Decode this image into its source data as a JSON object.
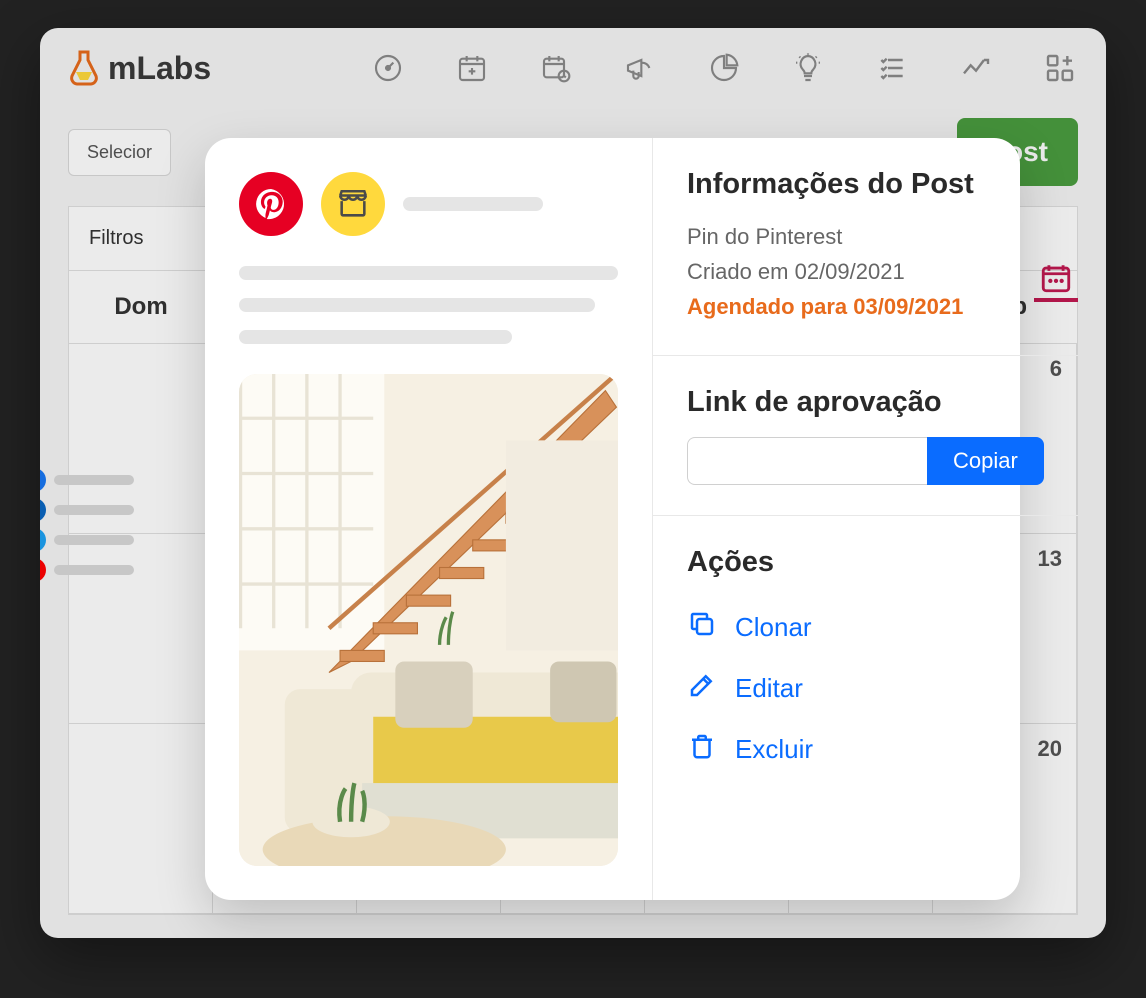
{
  "brand": "mLabs",
  "toolbar": {
    "select_label": "Selecior",
    "post_button": "Post",
    "filters_label": "Filtros"
  },
  "calendar": {
    "days": [
      "Dom",
      "",
      "",
      "",
      "",
      "",
      "Sab"
    ],
    "visible_dates": [
      "6",
      "13",
      "20"
    ]
  },
  "modal": {
    "info_title": "Informações do Post",
    "post_type": "Pin do Pinterest",
    "created_label": "Criado em 02/09/2021",
    "scheduled_label": "Agendado para 03/09/2021",
    "approval_title": "Link de aprovação",
    "copy_button": "Copiar",
    "actions_title": "Ações",
    "actions": {
      "clone": "Clonar",
      "edit": "Editar",
      "delete": "Excluir"
    }
  },
  "social_icons": [
    "facebook",
    "linkedin",
    "twitter",
    "youtube"
  ],
  "colors": {
    "pinterest": "#e60023",
    "yellow": "#ffd93d",
    "link": "#0a6cff",
    "orange": "#e86b1c",
    "green": "#4a9d3f",
    "magenta": "#c31952"
  }
}
